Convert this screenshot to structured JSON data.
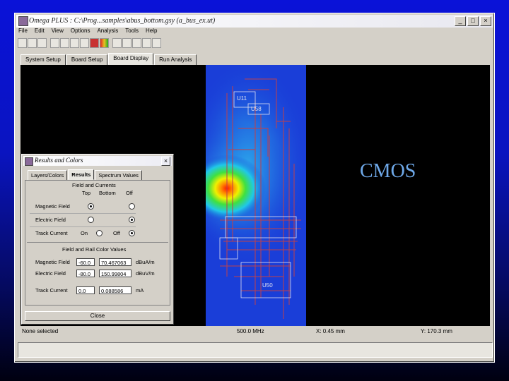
{
  "window": {
    "title": "Omega PLUS : C:\\Prog...samples\\abus_bottom.gsy (a_bus_ex.ut)",
    "controls": [
      "_",
      "□",
      "×"
    ]
  },
  "menu": [
    "File",
    "Edit",
    "View",
    "Options",
    "Analysis",
    "Tools",
    "Help"
  ],
  "tabs": [
    "System Setup",
    "Board Setup",
    "Board Display",
    "Run Analysis"
  ],
  "active_tab": "Board Display",
  "overlay_text": "CMOS",
  "board_labels": {
    "u11": "U11",
    "u50": "U50",
    "u58": "U58"
  },
  "status": {
    "selection": "None selected",
    "freq": "500.0 MHz",
    "x": "X: 0.45 mm",
    "y": "Y: 170.3 mm"
  },
  "dialog": {
    "title": "Results and Colors",
    "close_x": "×",
    "tabs": [
      "Layers/Colors",
      "Results",
      "Spectrum Values"
    ],
    "active_tab": "Results",
    "field_contours_title": "Field and Currents",
    "col_headers": [
      "Top",
      "Bottom",
      "Off"
    ],
    "rows": [
      {
        "label": "Magnetic Field"
      },
      {
        "label": "Electric Field"
      },
      {
        "label": "Track Current",
        "on": "On",
        "off": "Off"
      }
    ],
    "ranges_title": "Field and Rail Color Values",
    "ranges": [
      {
        "label": "Magnetic Field",
        "min": "-60.0",
        "max": "70.467063",
        "unit": "dBuA/m"
      },
      {
        "label": "Electric Field",
        "min": "-80.0",
        "max": "150.99804",
        "unit": "dBuV/m"
      },
      {
        "label": "Track Current",
        "min": "0.0",
        "max": "0.088586",
        "unit": "mA"
      }
    ],
    "close_label": "Close"
  }
}
